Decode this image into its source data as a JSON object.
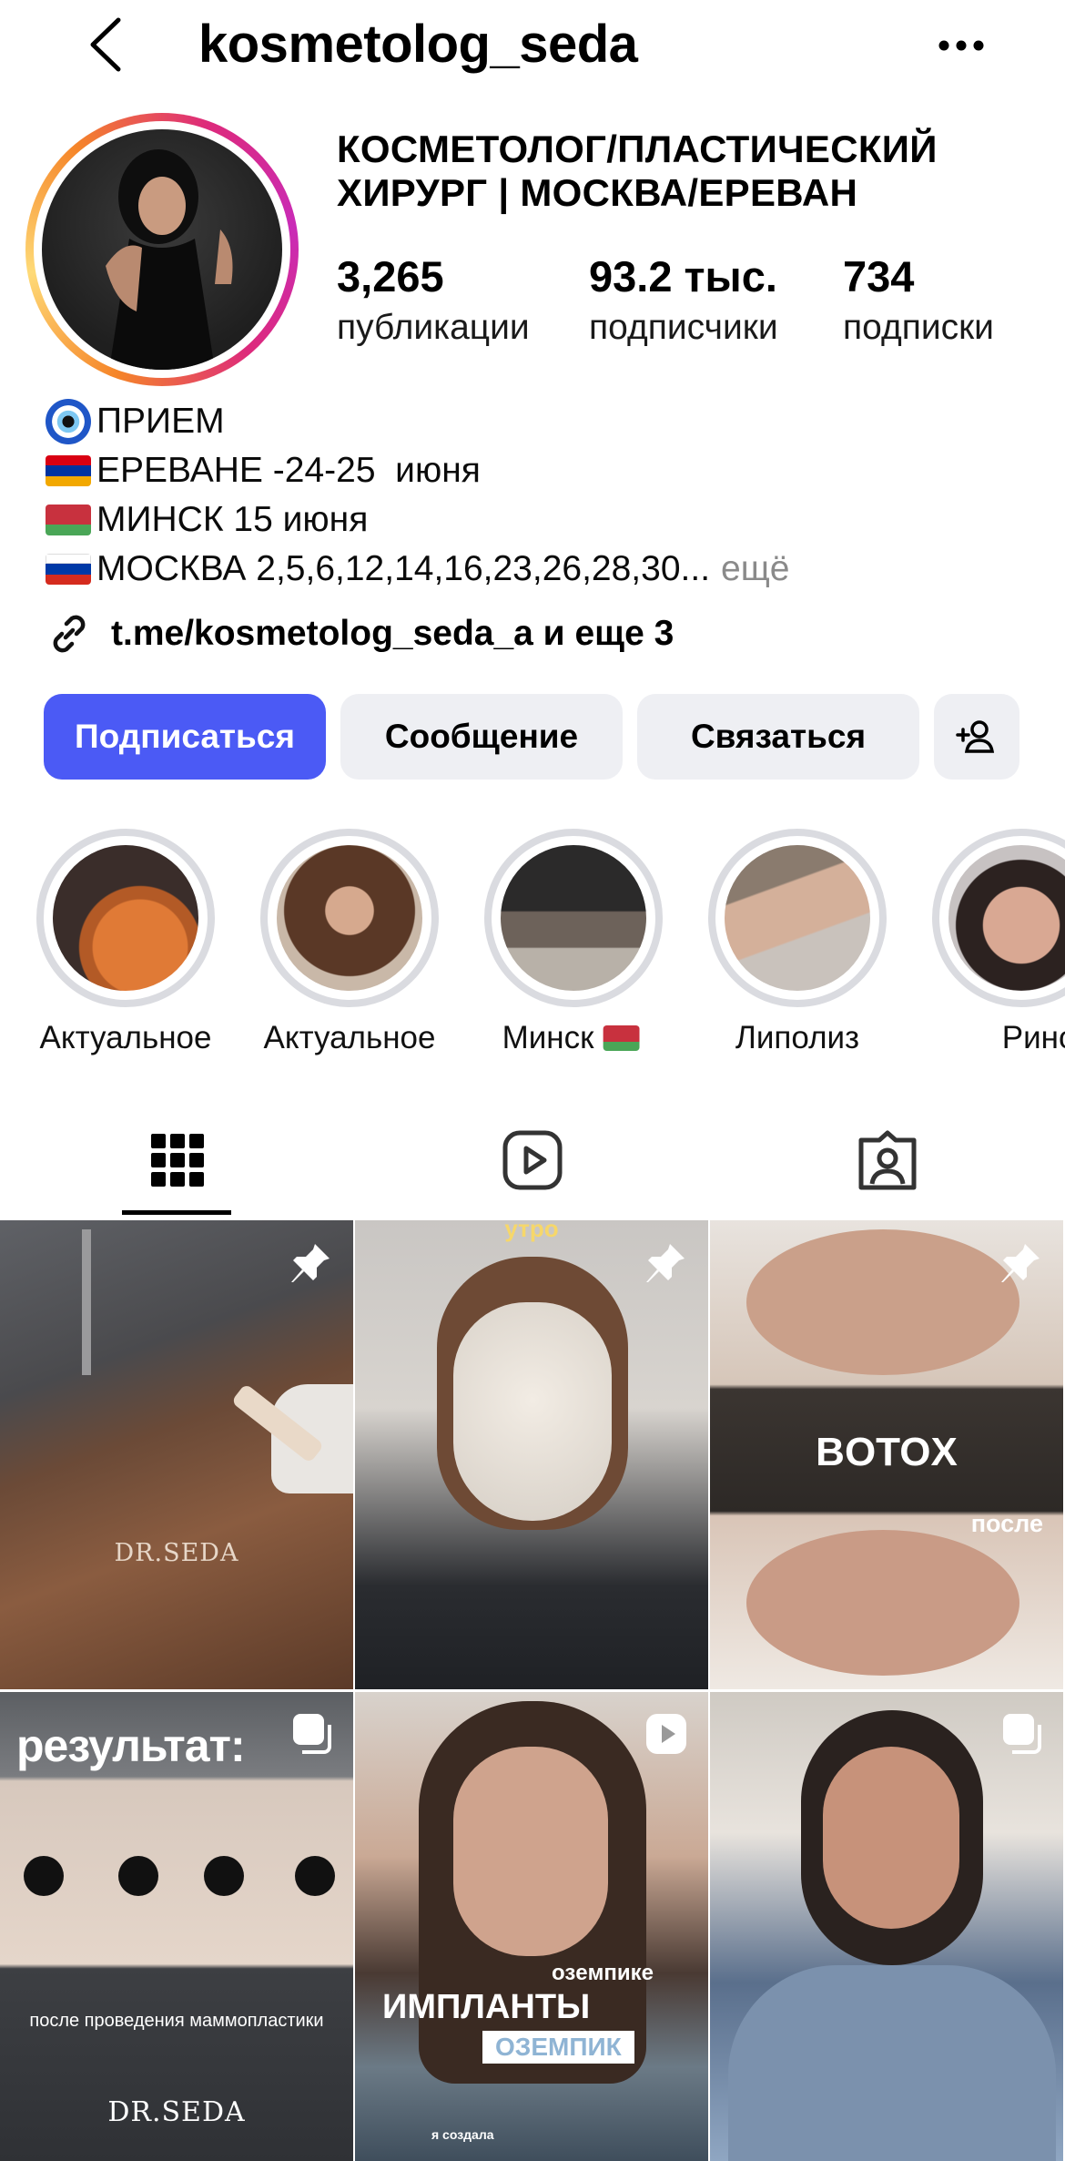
{
  "header": {
    "username": "kosmetolog_seda"
  },
  "profile": {
    "category": "КОСМЕТОЛОГ/ПЛАСТИЧЕСКИЙ ХИРУРГ | МОСКВА/ЕРЕВАН",
    "stats": [
      {
        "value": "3,265",
        "label": "публикации"
      },
      {
        "value": "93.2 тыс.",
        "label": "подписчики"
      },
      {
        "value": "734",
        "label": "подписки"
      }
    ],
    "bio": {
      "line1": "ПРИЕМ",
      "line2": "ЕРЕВАНЕ -24-25  июня",
      "line3": "МИНСК 15 июня",
      "line4": "МОСКВА 2,5,6,12,14,16,23,26,28,30...",
      "more": "ещё"
    },
    "link": "t.me/kosmetolog_seda_a и еще 3"
  },
  "actions": {
    "follow": "Подписаться",
    "message": "Сообщение",
    "contact": "Связаться"
  },
  "highlights": [
    {
      "label": "Актуальное"
    },
    {
      "label": "Актуальное"
    },
    {
      "label": "Минск"
    },
    {
      "label": "Липолиз"
    },
    {
      "label": "Рино"
    }
  ],
  "posts": {
    "p1_watermark": "DR.SEDA",
    "p2_top": "утро",
    "p3_title": "BOTOX",
    "p3_sub": "после",
    "p4_title": "результат:",
    "p4_caption": "после проведения маммопластики",
    "p4_watermark": "DR.SEDA",
    "p5_tag": "озeмпике",
    "p5_title": "ИМПЛАНТЫ",
    "p5_box": "ОЗЕМПИК",
    "p5_bottom": "я создала"
  },
  "colors": {
    "primary_button": "#4b5af5",
    "secondary_button": "#eeeff3",
    "muted_text": "#8a8a8a"
  }
}
